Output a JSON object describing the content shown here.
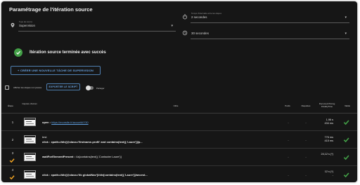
{
  "title": "Paramétrage de l'itération source",
  "fields": {
    "run_type": {
      "label": "Type de source",
      "value": "Supervision"
    },
    "interval": {
      "label": "Temps d'intervalle entre les étapes",
      "value": "2 secondes"
    },
    "timeout": {
      "label": "",
      "value": "30 secondes"
    }
  },
  "success_message": "Itération source terminée avec succès",
  "create_button": "+ CRÉER UNE NOUVELLE TÂCHE DE SUPERVISION",
  "checkbox_label": "Afficher les étapes non jouées",
  "export_button": "EXPORTER LE SCRIPT",
  "toggle_label": "Partager",
  "columns": {
    "step": "Étape",
    "capture": "Capture d'écran",
    "cible": "Cible",
    "poids": "Poids",
    "requetes": "Requêtes",
    "duration": "DocumentTiming FinalityTime",
    "valide": "Valide"
  },
  "rows": [
    {
      "num": "1",
      "kw": "open :",
      "text": "",
      "link": "https://monsite.fr/accueil#Y30",
      "extra": "",
      "poids": "-",
      "requetes": "-",
      "duration": [
        "1,96 s",
        "434 ms"
      ],
      "warn": false
    },
    {
      "num": "2",
      "kw": "",
      "line1": "test",
      "text": "click : xpath=//div[@class='firstname-profil' and contains(text(),'Laure')]/p...",
      "link": "",
      "poids": "-",
      "requetes": "-",
      "duration": [
        "776 ms",
        "415 ms"
      ],
      "warn": false
    },
    {
      "num": "3",
      "kw": "waitForElementPresent :",
      "text": "//a[contains(text(),'Contacter Laure')]",
      "link": "",
      "poids": "-",
      "requetes": "-",
      "duration": [
        "24,12 s (*)",
        ""
      ],
      "warn": true
    },
    {
      "num": "4",
      "kw": "",
      "line1": "",
      "text": "click : xpath=//div[@class='lib globalNav']//div[contains(text(),'Laure')]/ancest...",
      "link": "",
      "poids": "-",
      "requetes": "-",
      "duration": [
        "12 s (*)",
        "-"
      ],
      "warn": true
    }
  ],
  "colors": {
    "background": "#161616",
    "accent": "#6aa6e6",
    "success": "#43a047",
    "warning": "#f5a623"
  },
  "icons": [
    "map-pin-icon",
    "timer-icon",
    "clock-icon",
    "check-circle-icon",
    "check-icon",
    "warning-icon",
    "chevron-down-icon"
  ]
}
